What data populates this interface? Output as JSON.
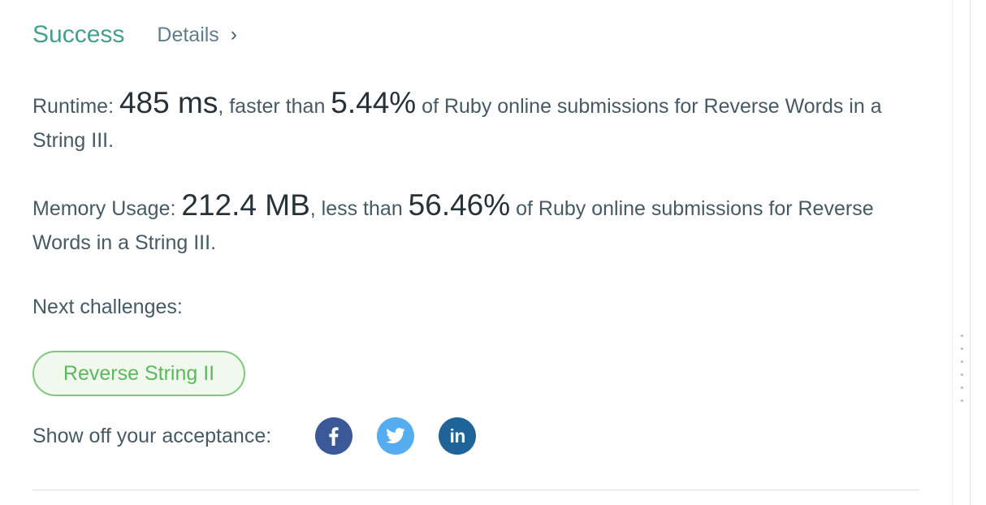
{
  "result": {
    "status": "Success",
    "details_label": "Details",
    "details_chevron": "›"
  },
  "runtime": {
    "label": "Runtime: ",
    "value": "485 ms",
    "comparison": ", faster than ",
    "percent": "5.44%",
    "suffix": " of Ruby online submissions for Reverse Words in a String III."
  },
  "memory": {
    "label": "Memory Usage: ",
    "value": "212.4 MB",
    "comparison": ", less than ",
    "percent": "56.46%",
    "suffix": " of Ruby online submissions for Reverse Words in a String III."
  },
  "next_challenges": {
    "label": "Next challenges:",
    "items": [
      "Reverse String II"
    ]
  },
  "share": {
    "label": "Show off your acceptance:",
    "icons": [
      "facebook-icon",
      "twitter-icon",
      "linkedin-icon"
    ],
    "linkedin_text": "in"
  },
  "colors": {
    "success": "#43a08b",
    "challenge_green": "#5cb85c",
    "facebook": "#3b5998",
    "twitter": "#55acee",
    "linkedin": "#1f6499"
  }
}
